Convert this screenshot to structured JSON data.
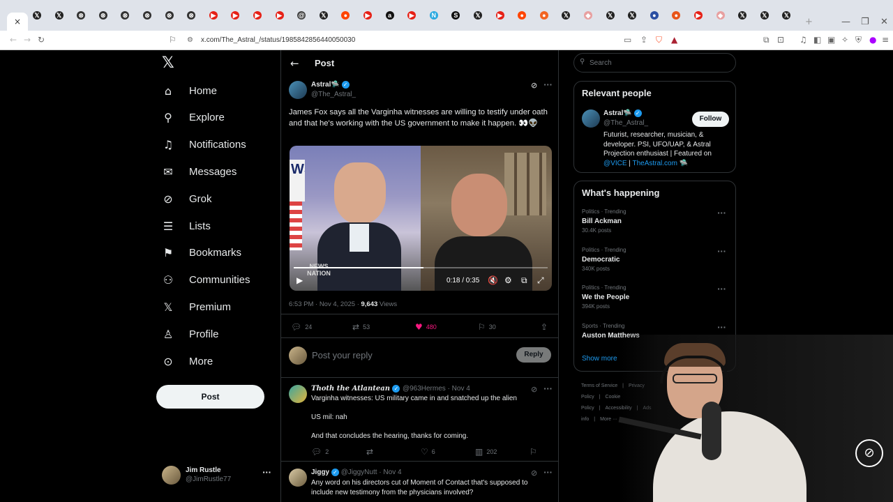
{
  "browser": {
    "url": "x.com/The_Astral_/status/1985842856440050030",
    "active_tab_close": "×",
    "new_tab": "+",
    "tabs": [
      {
        "icon": "x-logo-icon",
        "color": "#222222",
        "glyph": "𝕏"
      },
      {
        "icon": "x-logo-icon",
        "color": "#222222",
        "glyph": "𝕏"
      },
      {
        "icon": "circle-x-icon",
        "color": "#333333",
        "glyph": "⊗"
      },
      {
        "icon": "circle-x-icon",
        "color": "#333333",
        "glyph": "⊗"
      },
      {
        "icon": "circle-x-icon",
        "color": "#333333",
        "glyph": "⊗"
      },
      {
        "icon": "circle-x-icon",
        "color": "#333333",
        "glyph": "⊗"
      },
      {
        "icon": "circle-x-icon",
        "color": "#333333",
        "glyph": "⊗"
      },
      {
        "icon": "circle-x-icon",
        "color": "#333333",
        "glyph": "⊗"
      },
      {
        "icon": "youtube-icon",
        "color": "#e62117",
        "glyph": "▶"
      },
      {
        "icon": "youtube-icon",
        "color": "#e62117",
        "glyph": "▶"
      },
      {
        "icon": "youtube-icon",
        "color": "#e62117",
        "glyph": "▶"
      },
      {
        "icon": "youtube-icon",
        "color": "#e62117",
        "glyph": "▶"
      },
      {
        "icon": "threads-icon",
        "color": "#444444",
        "glyph": "@"
      },
      {
        "icon": "x-logo-icon",
        "color": "#222222",
        "glyph": "𝕏"
      },
      {
        "icon": "reddit-icon",
        "color": "#ff4500",
        "glyph": "●"
      },
      {
        "icon": "youtube-icon",
        "color": "#e62117",
        "glyph": "▶"
      },
      {
        "icon": "abc-icon",
        "color": "#111111",
        "glyph": "a"
      },
      {
        "icon": "youtube-icon",
        "color": "#e62117",
        "glyph": "▶"
      },
      {
        "icon": "news-icon",
        "color": "#2aa9e0",
        "glyph": "N"
      },
      {
        "icon": "s-icon",
        "color": "#111111",
        "glyph": "S"
      },
      {
        "icon": "x-logo-icon",
        "color": "#222222",
        "glyph": "𝕏"
      },
      {
        "icon": "youtube-icon",
        "color": "#e62117",
        "glyph": "▶"
      },
      {
        "icon": "reddit-icon",
        "color": "#ff4500",
        "glyph": "●"
      },
      {
        "icon": "orange-circle-icon",
        "color": "#f26522",
        "glyph": "●"
      },
      {
        "icon": "x-logo-icon",
        "color": "#222222",
        "glyph": "𝕏"
      },
      {
        "icon": "shield-icon",
        "color": "#e8a0a0",
        "glyph": "◆"
      },
      {
        "icon": "x-logo-icon",
        "color": "#222222",
        "glyph": "𝕏"
      },
      {
        "icon": "x-logo-icon",
        "color": "#222222",
        "glyph": "𝕏"
      },
      {
        "icon": "blue-circle-icon",
        "color": "#2b4fa3",
        "glyph": "●"
      },
      {
        "icon": "orange-circle-icon",
        "color": "#e8551a",
        "glyph": "●"
      },
      {
        "icon": "youtube-icon",
        "color": "#e62117",
        "glyph": "▶"
      },
      {
        "icon": "shield-icon",
        "color": "#e8a0a0",
        "glyph": "◆"
      },
      {
        "icon": "x-logo-icon",
        "color": "#222222",
        "glyph": "𝕏"
      },
      {
        "icon": "x-logo-icon",
        "color": "#222222",
        "glyph": "𝕏"
      },
      {
        "icon": "x-logo-icon",
        "color": "#222222",
        "glyph": "𝕏"
      }
    ]
  },
  "nav": {
    "logo": "𝕏",
    "items": [
      {
        "label": "Home",
        "icon": "home-icon",
        "glyph": "⌂"
      },
      {
        "label": "Explore",
        "icon": "search-icon",
        "glyph": "⚲"
      },
      {
        "label": "Notifications",
        "icon": "bell-icon",
        "glyph": "♫"
      },
      {
        "label": "Messages",
        "icon": "envelope-icon",
        "glyph": "✉"
      },
      {
        "label": "Grok",
        "icon": "grok-icon",
        "glyph": "⊘"
      },
      {
        "label": "Lists",
        "icon": "list-icon",
        "glyph": "☰"
      },
      {
        "label": "Bookmarks",
        "icon": "bookmark-icon",
        "glyph": "⚑"
      },
      {
        "label": "Communities",
        "icon": "people-icon",
        "glyph": "⚇"
      },
      {
        "label": "Premium",
        "icon": "x-logo-icon",
        "glyph": "𝕏"
      },
      {
        "label": "Profile",
        "icon": "person-icon",
        "glyph": "♙"
      },
      {
        "label": "More",
        "icon": "more-circle-icon",
        "glyph": "⊙"
      }
    ],
    "post_button": "Post",
    "user": {
      "name": "Jim Rustle",
      "handle": "@JimRustle77",
      "more": "···"
    }
  },
  "header": {
    "back": "←",
    "title": "Post"
  },
  "post": {
    "author": "Astral🛸",
    "handle": "@The_Astral_",
    "text": "James Fox says all the Varginha witnesses are willing to testify under oath and that he's working with the US government to make it happen. 👀👽",
    "video": {
      "time": "0:18 / 0:35",
      "watermark": "NEWS NATION",
      "progress": 0.51,
      "left_sign": "WS ION"
    },
    "time": "6:53 PM · Nov 4, 2025 ·",
    "views_count": "9,643",
    "views_label": "Views",
    "replies": "24",
    "reposts": "53",
    "likes": "480",
    "bookmarks": "30",
    "like_color": "#f91880"
  },
  "reply_box": {
    "placeholder": "Post your reply",
    "button": "Reply"
  },
  "replies": [
    {
      "name": "Thoth the Atlantean",
      "handle": "@963Hermes · Nov 4",
      "lines": [
        "Varginha witnesses: US military came in and snatched up the alien",
        "US mil: nah",
        "And that concludes the hearing, thanks for coming."
      ],
      "replies": "2",
      "likes": "6",
      "views": "202"
    },
    {
      "name": "Jiggy",
      "handle": "@JiggyNutt · Nov 4",
      "lines": [
        "Any word on his directors cut of Moment of Contact that's supposed to include new testimony from the physicians involved?"
      ]
    }
  ],
  "search": {
    "placeholder": "Search"
  },
  "relevant": {
    "title": "Relevant people",
    "name": "Astral🛸",
    "handle": "@The_Astral_",
    "follow": "Follow",
    "bio": "Futurist, researcher, musician, & developer. PSI, UFO/UAP, & Astral Projection enthusiast | Featured on",
    "bio_link1": "@VICE",
    "bio_sep": " | ",
    "bio_link2": "TheAstral.com 🛸"
  },
  "happening": {
    "title": "What's happening",
    "trends": [
      {
        "context": "Politics · Trending",
        "topic": "Bill Ackman",
        "posts": "30.4K posts"
      },
      {
        "context": "Politics · Trending",
        "topic": "Democratic",
        "posts": "340K posts"
      },
      {
        "context": "Politics · Trending",
        "topic": "We the People",
        "posts": "394K posts"
      },
      {
        "context": "Sports · Trending",
        "topic": "Auston Matthews",
        "posts": ""
      }
    ],
    "show_more": "Show more"
  },
  "footer": {
    "links": [
      "Terms of Service",
      "|",
      "Privacy Policy",
      "|",
      "Cookie Policy",
      "|",
      "Accessibility",
      "|",
      "Ads info",
      "|",
      "More ···"
    ]
  },
  "colors": {
    "accent": "#1d9bf0",
    "brand_red": "#f91880"
  }
}
